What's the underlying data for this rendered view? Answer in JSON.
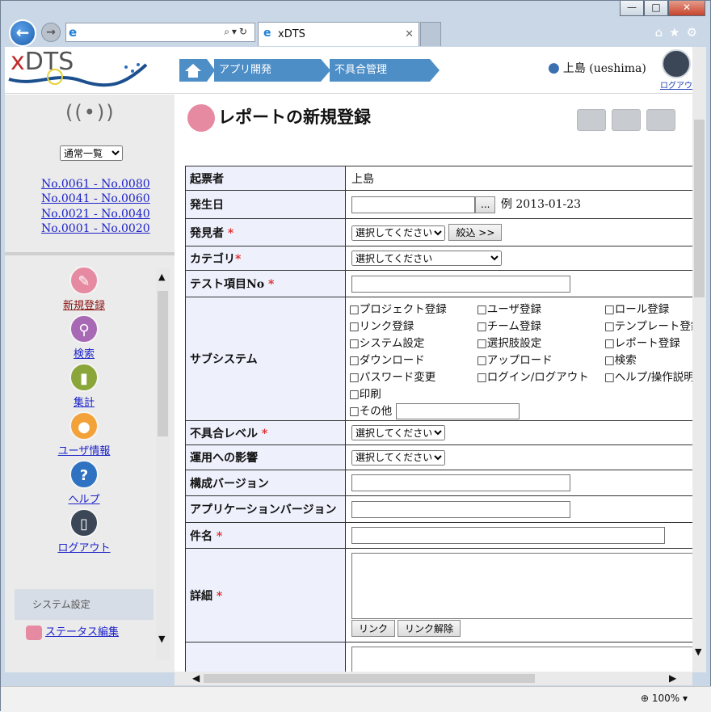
{
  "browser": {
    "tab_title": "xDTS",
    "zoom": "100%"
  },
  "header": {
    "logo_text_x": "x",
    "logo_text_rest": "DTS",
    "breadcrumbs": [
      "アプリ開発",
      "不具合管理"
    ],
    "user_name": "上島 (ueshima)",
    "logout_label": "ログアウト"
  },
  "sidebar": {
    "view_select": "通常一覧",
    "ranges": [
      "No.0061 - No.0080",
      "No.0041 - No.0060",
      "No.0021 - No.0040",
      "No.0001 - No.0020"
    ],
    "menu": [
      {
        "label": "新規登録",
        "icon": "edit-icon",
        "color": "#e68aa2"
      },
      {
        "label": "検索",
        "icon": "search-icon",
        "color": "#a769b4"
      },
      {
        "label": "集計",
        "icon": "chart-icon",
        "color": "#8aa53a"
      },
      {
        "label": "ユーザ情報",
        "icon": "user-icon",
        "color": "#f3a23a"
      },
      {
        "label": "ヘルプ",
        "icon": "help-icon",
        "color": "#2f72c2"
      },
      {
        "label": "ログアウト",
        "icon": "logout-icon",
        "color": "#3b4756"
      }
    ],
    "system_settings": "システム設定",
    "status_edit": "ステータス編集"
  },
  "main": {
    "title": "レポートの新規登録",
    "form": {
      "reporter_label": "起票者",
      "reporter_value": "上島",
      "date_label": "発生日",
      "date_button": "...",
      "date_example": "例 2013-01-23",
      "finder_label": "発見者",
      "finder_select": "選択してください",
      "finder_filter": "絞込 >>",
      "category_label": "カテゴリ",
      "category_select": "選択してください",
      "testno_label": "テスト項目No",
      "subsystem_label": "サブシステム",
      "subsystems": [
        "□プロジェクト登録",
        "□ユーザ登録",
        "□ロール登録",
        "□リンク登録",
        "□チーム登録",
        "□テンプレート登録",
        "□システム設定",
        "□選択肢設定",
        "□レポート登録",
        "□ダウンロード",
        "□アップロード",
        "□検索",
        "□パスワード変更",
        "□ログイン/ログアウト",
        "□ヘルプ/操作説明",
        "□印刷"
      ],
      "subsystem_other": "□その他",
      "level_label": "不具合レベル",
      "level_select": "選択してください",
      "impact_label": "運用への影響",
      "impact_select": "選択してください",
      "config_version_label": "構成バージョン",
      "app_version_label": "アプリケーションバージョン",
      "subject_label": "件名",
      "detail_label": "詳細",
      "link_button": "リンク",
      "unlink_button": "リンク解除",
      "required_mark": "*"
    }
  }
}
